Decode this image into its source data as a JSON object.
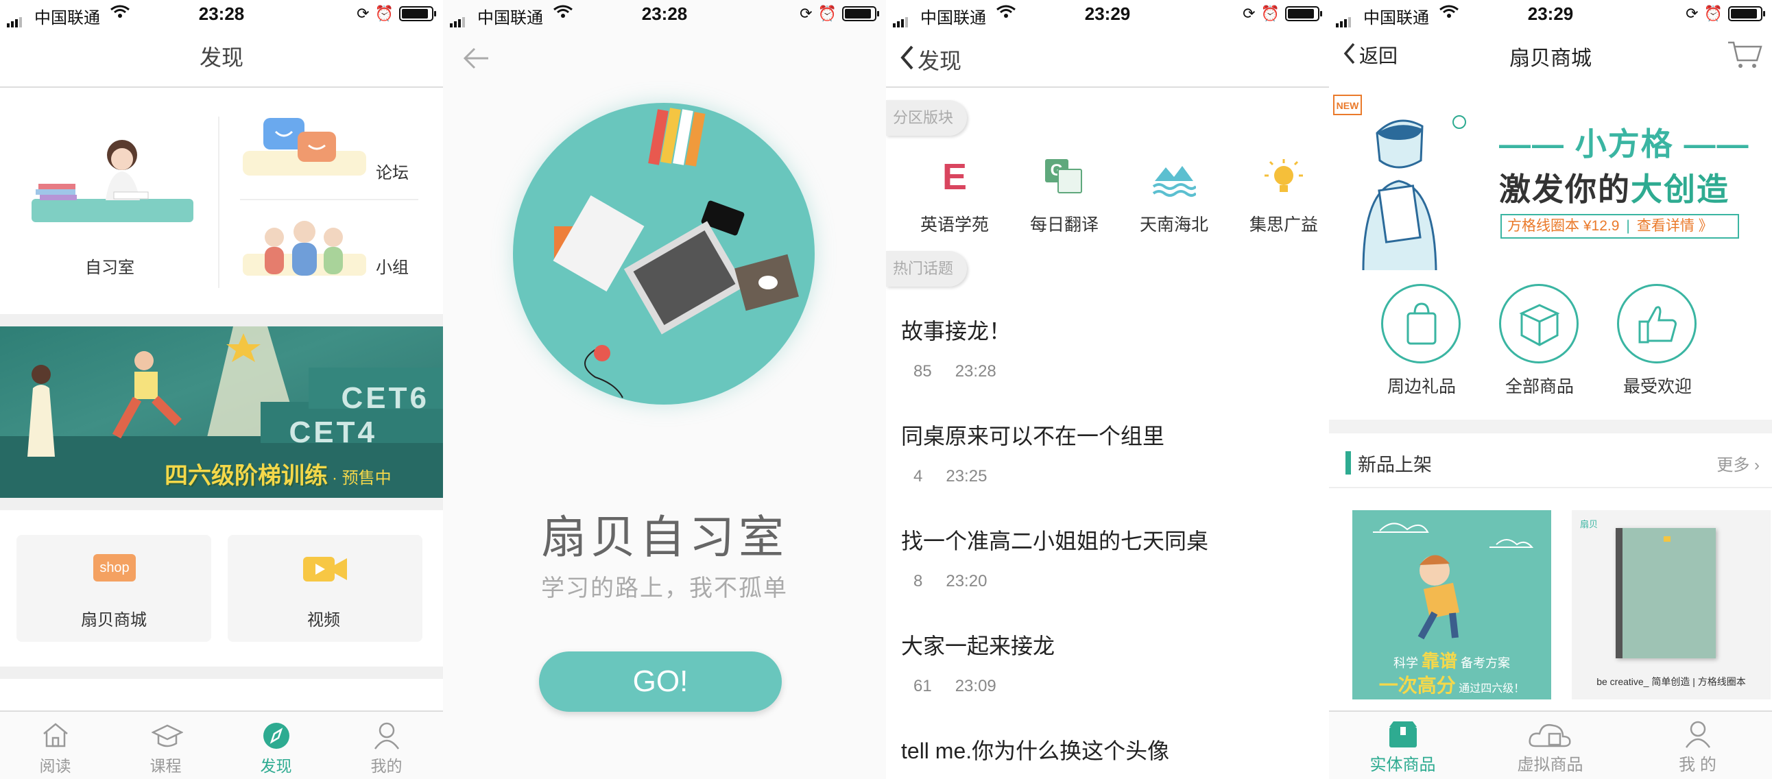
{
  "status_bars": [
    {
      "carrier": "中国联通",
      "time": "23:28"
    },
    {
      "carrier": "中国联通",
      "time": "23:28"
    },
    {
      "carrier": "中国联通",
      "time": "23:29"
    },
    {
      "carrier": "中国联通",
      "time": "23:29"
    }
  ],
  "screen1": {
    "title": "发现",
    "study_room": "自习室",
    "forum": "论坛",
    "group": "小组",
    "banner": {
      "line1": "CET6",
      "line2": "CET4",
      "caption": "四六级阶梯训练",
      "badge": "· 预售中"
    },
    "cards": [
      {
        "label": "扇贝商城",
        "icon_text": "shop"
      },
      {
        "label": "视频"
      }
    ],
    "tabs": [
      {
        "label": "阅读",
        "icon": "home-icon"
      },
      {
        "label": "课程",
        "icon": "graduation-cap-icon"
      },
      {
        "label": "发现",
        "icon": "compass-icon",
        "active": true
      },
      {
        "label": "我的",
        "icon": "user-icon"
      }
    ]
  },
  "screen2": {
    "title": "扇贝自习室",
    "subtitle": "学习的路上，我不孤单",
    "go_label": "GO!"
  },
  "screen3": {
    "back_title": "发现",
    "section1": "分区版块",
    "section2": "热门话题",
    "categories": [
      {
        "label": "英语学苑",
        "glyph": "E"
      },
      {
        "label": "每日翻译",
        "glyph": "G"
      },
      {
        "label": "天南海北"
      },
      {
        "label": "集思广益"
      }
    ],
    "topics": [
      {
        "title": "故事接龙！",
        "count": "85",
        "time": "23:28"
      },
      {
        "title": "同桌原来可以不在一个组里",
        "count": "4",
        "time": "23:25"
      },
      {
        "title": "找一个准高二小姐姐的七天同桌",
        "count": "8",
        "time": "23:20"
      },
      {
        "title": "大家一起来接龙",
        "count": "61",
        "time": "23:09"
      },
      {
        "title": "tell me.你为什么换这个头像",
        "count": "",
        "time": ""
      }
    ]
  },
  "screen4": {
    "back_label": "返回",
    "title": "扇贝商城",
    "promo": {
      "new_badge": "NEW",
      "line1": "—— 小方格 ——",
      "line2_prefix": "激发你的",
      "line2_highlight": "大创造",
      "line3_left": "方格线圈本 ¥12.9",
      "line3_right": "查看详情 》"
    },
    "categories": [
      {
        "label": "周边礼品"
      },
      {
        "label": "全部商品"
      },
      {
        "label": "最受欢迎"
      }
    ],
    "section_title": "新品上架",
    "more": "更多",
    "products": [
      {
        "line1_a": "科学",
        "line1_b": "靠谱",
        "line1_c": "备考方案",
        "line2_a": "一次高分",
        "line2_b": "通过四六级！"
      },
      {
        "brand": "扇贝",
        "caption": "be creative_  简单创造 | 方格线圈本"
      }
    ],
    "tabs": [
      {
        "label": "实体商品",
        "active": true
      },
      {
        "label": "虚拟商品"
      },
      {
        "label": "我 的"
      }
    ]
  },
  "colors": {
    "accent": "#2eab91",
    "teal": "#69c6bd",
    "orange": "#ea7a2b"
  }
}
